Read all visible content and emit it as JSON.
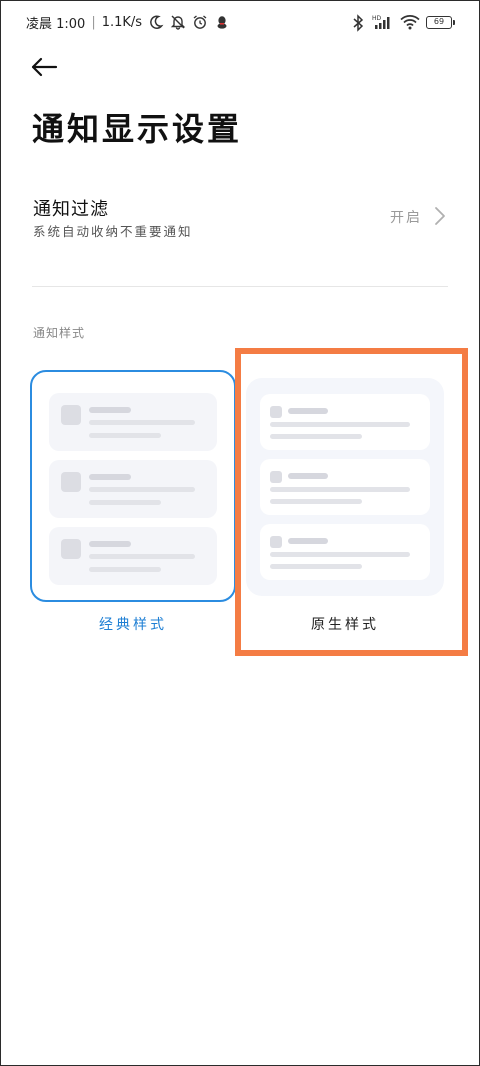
{
  "status_bar": {
    "time": "凌晨 1:00",
    "network_speed": "1.1K/s",
    "battery_level": "69",
    "icons": [
      "moon-icon",
      "bell-off-icon",
      "alarm-icon",
      "qq-icon",
      "bluetooth-icon",
      "signal-icon",
      "wifi-icon",
      "battery-icon"
    ]
  },
  "header": {
    "back_icon": "arrow-left-icon",
    "title": "通知显示设置"
  },
  "filter": {
    "title": "通知过滤",
    "subtitle": "系统自动收纳不重要通知",
    "value": "开启"
  },
  "style_section": {
    "label": "通知样式",
    "options": [
      {
        "label": "经典样式",
        "selected": true
      },
      {
        "label": "原生样式",
        "selected": false
      }
    ]
  },
  "colors": {
    "accent": "#2b8ce0",
    "highlight": "#f47c44"
  }
}
